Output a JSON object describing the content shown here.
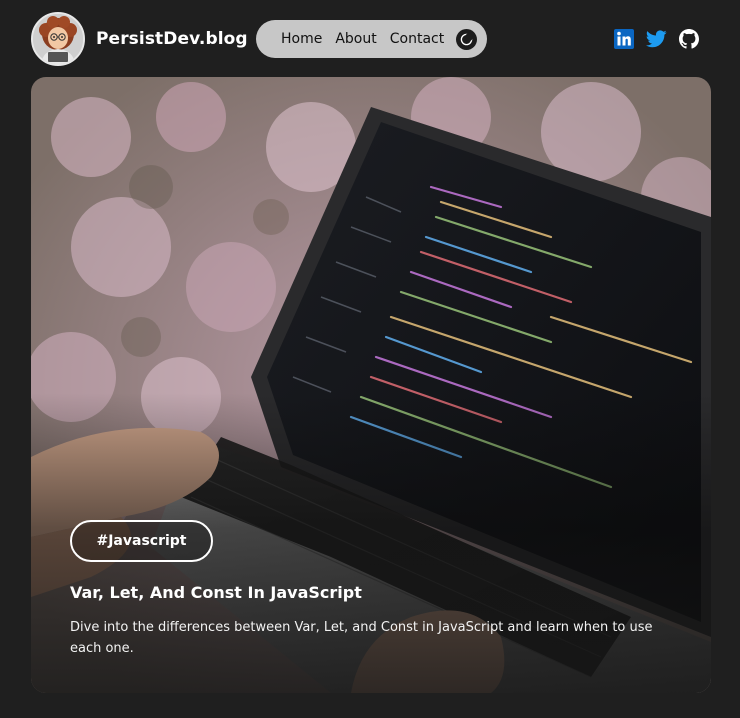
{
  "site": {
    "title": "PersistDev.blog"
  },
  "nav": {
    "items": [
      {
        "label": "Home"
      },
      {
        "label": "About"
      },
      {
        "label": "Contact"
      }
    ],
    "theme_toggle_icon": "moon-icon"
  },
  "social": {
    "items": [
      {
        "icon": "linkedin-icon",
        "color": "#0a66c2"
      },
      {
        "icon": "twitter-icon",
        "color": "#1d9bf0"
      },
      {
        "icon": "github-icon",
        "color": "#ffffff"
      }
    ]
  },
  "post": {
    "tag": "#Javascript",
    "title": "Var, Let, And Const In JavaScript",
    "description": "Dive into the differences between Var, Let, and Const in JavaScript and learn when to use each one."
  },
  "colors": {
    "background": "#1f1f1f",
    "nav_background": "#c7c7c7"
  }
}
